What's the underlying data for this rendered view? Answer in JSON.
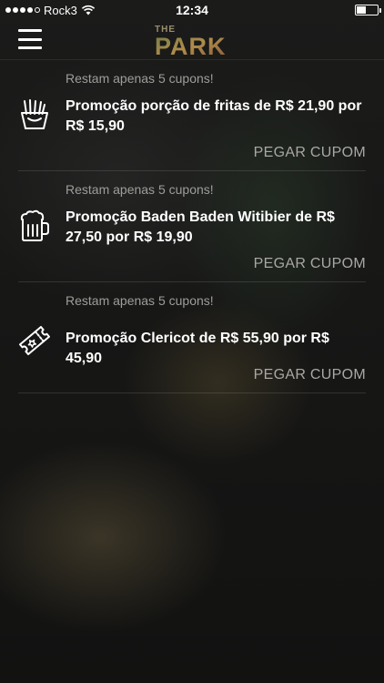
{
  "status_bar": {
    "carrier": "Rock3",
    "time": "12:34",
    "signal_bars": 4,
    "signal_total": 5,
    "battery_level": 0.45
  },
  "header": {
    "menu_icon": "hamburger-icon",
    "logo_text_top": "THE",
    "logo_text_main": "PARK"
  },
  "coupons": [
    {
      "remaining": "Restam apenas 5 cupons!",
      "title": "Promoção porção de fritas de R$ 21,90 por R$ 15,90",
      "icon": "fries-icon",
      "action": "PEGAR CUPOM"
    },
    {
      "remaining": "Restam apenas 5 cupons!",
      "title": "Promoção Baden Baden Witibier de R$ 27,50 por R$ 19,90",
      "icon": "beer-mug-icon",
      "action": "PEGAR CUPOM"
    },
    {
      "remaining": "Restam apenas 5 cupons!",
      "title": "Promoção Clericot de R$ 55,90 por R$ 45,90",
      "icon": "ticket-icon",
      "action": "PEGAR CUPOM"
    }
  ],
  "colors": {
    "background": "#151513",
    "muted_text": "#9d9d9a",
    "cta_text": "#a8a8a5"
  }
}
